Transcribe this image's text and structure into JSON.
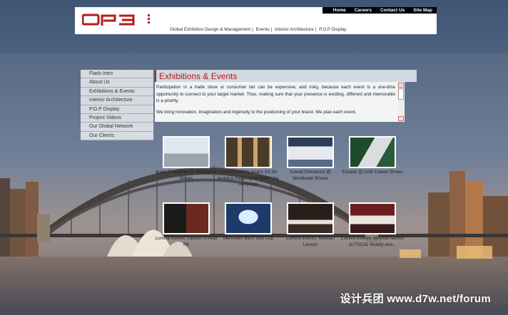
{
  "top_nav": [
    "Home",
    "Careers",
    "Contact Us",
    "Site Map"
  ],
  "logo": {
    "text": "OP3",
    "color": "#b31b1b"
  },
  "tagline": [
    "Global Exhibition Design & Management",
    "Events",
    "Interior Architecture",
    "P.O.P Display"
  ],
  "menu": [
    "Flash Intro",
    "About Us",
    "Exhibitions & Events",
    "Interior Architecture",
    "P.O.P Display",
    "Project Videos",
    "Our Global Network",
    "Our Clients"
  ],
  "content": {
    "title": "Exhibitions & Events",
    "paragraphs": [
      "Participation in a trade show or consumer fair can be expensive, and risky, because each event is a one-time opportunity to connect to your target market. Thus, making sure that your presence is exciting, different and memorable is a priority.",
      "We bring Innovation, Imagination and Ingenuity to the positioning of your brand. We plan each event,"
    ]
  },
  "projects": [
    {
      "caption": "Qatar Petroleum @ Worldwide Shows"
    },
    {
      "caption": "Lumina Events: Asia's 1st 3D building mapping for BMW Joy campaign"
    },
    {
      "caption": "Kuwait Petroleum @ Worldwide Shows"
    },
    {
      "caption": "Etisalat @ UAE Career Shows"
    },
    {
      "caption": "Lumina Events: Launch of Audi R8"
    },
    {
      "caption": "Mercedes Benz Golf Cup"
    },
    {
      "caption": "Lumina Events: Meydan Launch"
    },
    {
      "caption": "Lumina Events: Meydan launch at FOCAL Reality and..."
    }
  ],
  "watermark": "设计兵团 www.d7w.net/forum",
  "colors": {
    "accent": "#b31b1b",
    "header_bg": "#ffffff",
    "topnav_bg": "#000000"
  }
}
